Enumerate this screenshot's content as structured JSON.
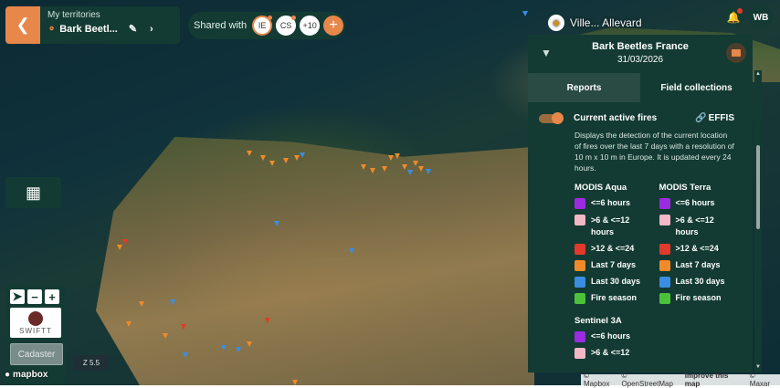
{
  "territory": {
    "label": "My territories",
    "name": "Bark Beetl..."
  },
  "share": {
    "label": "Shared with",
    "users": [
      "IE",
      "CS",
      "+10"
    ],
    "add_label": "+"
  },
  "map_place": {
    "label": "Ville... Allevard"
  },
  "user_initials": "WB",
  "panel": {
    "title": "Bark Beetles France",
    "date": "31/03/2026",
    "tabs": [
      "Reports",
      "Field collections"
    ],
    "layer": {
      "name": "Current active fires",
      "source_link": "EFFIS",
      "description": "Displays the detection of the current location of fires over the last 7 days with a resolution of 10 m x 10 m in Europe. It is updated every 24 hours."
    },
    "legend": [
      {
        "title": "MODIS Aqua",
        "items": [
          {
            "label": "<=6 hours",
            "color": "#9b2be0"
          },
          {
            "label": ">6 & <=12 hours",
            "color": "#f2b8c6"
          },
          {
            "label": ">12 & <=24",
            "color": "#e23a2a"
          },
          {
            "label": "Last 7 days",
            "color": "#f08a2a"
          },
          {
            "label": "Last 30 days",
            "color": "#3a8de0"
          },
          {
            "label": "Fire season",
            "color": "#4cc23a"
          }
        ]
      },
      {
        "title": "MODIS Terra",
        "items": [
          {
            "label": "<=6 hours",
            "color": "#9b2be0"
          },
          {
            "label": ">6 & <=12 hours",
            "color": "#f2b8c6"
          },
          {
            "label": ">12 & <=24",
            "color": "#e23a2a"
          },
          {
            "label": "Last 7 days",
            "color": "#f08a2a"
          },
          {
            "label": "Last 30 days",
            "color": "#3a8de0"
          },
          {
            "label": "Fire season",
            "color": "#4cc23a"
          }
        ]
      }
    ],
    "sentinel": {
      "title": "Sentinel 3A",
      "items": [
        {
          "label": "<=6 hours",
          "color": "#9b2be0"
        },
        {
          "label": ">6 & <=12",
          "color": "#f2b8c6"
        }
      ]
    }
  },
  "controls": {
    "swift_label": "SWIFTT",
    "cadastre_label": "Cadaster",
    "scale_label": "Z 5.5"
  },
  "mapbox_logo": "mapbox",
  "attribution": {
    "mapbox": "© Mapbox",
    "osm": "© OpenStreetMap",
    "improve": "Improve this map",
    "maxar": "© Maxar"
  }
}
